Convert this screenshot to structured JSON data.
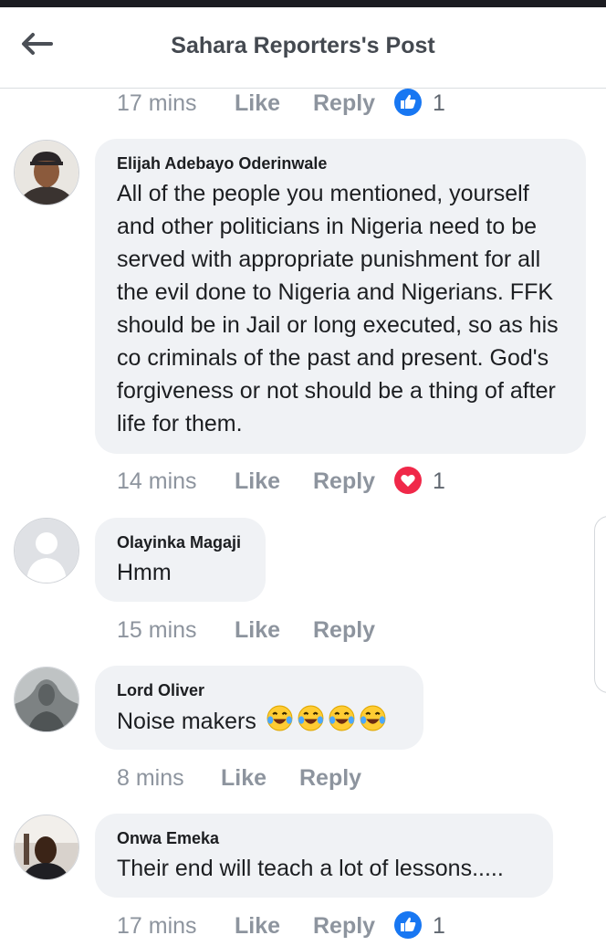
{
  "header": {
    "title": "Sahara Reporters's Post",
    "back_icon": "back-arrow-icon"
  },
  "top_actions": {
    "time": "17 mins",
    "like": "Like",
    "reply": "Reply",
    "reaction_icon": "like-reaction-icon",
    "reaction_count": "1"
  },
  "comments": [
    {
      "author": "Elijah Adebayo Oderinwale",
      "text": "All of the people you mentioned, yourself and other politicians in Nigeria need to be served with appropriate punishment for all the evil done to Nigeria and Nigerians. FFK should be in Jail or long executed, so as his co criminals of the past and present. God's forgiveness or not should be a thing of after life for them.",
      "time": "14 mins",
      "like": "Like",
      "reply": "Reply",
      "reaction_icon": "love-reaction-icon",
      "reaction_count": "1"
    },
    {
      "author": "Olayinka Magaji",
      "text": "Hmm",
      "time": "15 mins",
      "like": "Like",
      "reply": "Reply"
    },
    {
      "author": "Lord Oliver",
      "text": "Noise makers",
      "emojis": [
        "laughing-crying-emoji",
        "laughing-crying-emoji",
        "laughing-crying-emoji",
        "laughing-crying-emoji"
      ],
      "time": "8 mins",
      "like": "Like",
      "reply": "Reply"
    },
    {
      "author": "Onwa Emeka",
      "text": "Their end will teach a lot of lessons.....",
      "time": "17 mins",
      "like": "Like",
      "reply": "Reply",
      "reaction_icon": "like-reaction-icon",
      "reaction_count": "1"
    }
  ],
  "colors": {
    "like_blue": "#1877f2",
    "love_red": "#f02849",
    "bubble_bg": "#f0f2f5",
    "muted_text": "#8d949e"
  }
}
